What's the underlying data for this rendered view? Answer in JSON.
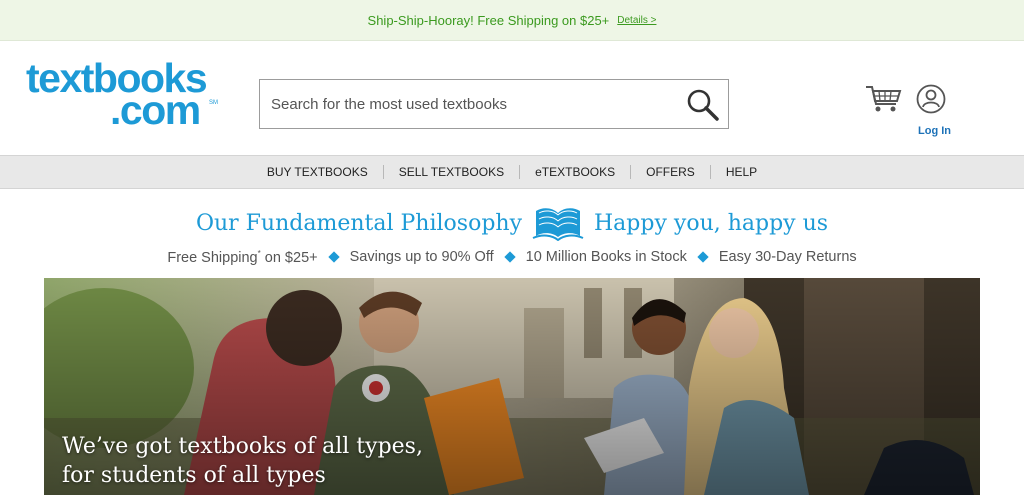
{
  "promo": {
    "text": "Ship-Ship-Hooray! Free Shipping on $25+",
    "link": "Details >"
  },
  "logo": {
    "line1": "textbooks",
    "line2": ".com",
    "sm": "SM"
  },
  "search": {
    "placeholder": "Search for the most used textbooks"
  },
  "header": {
    "login": "Log In"
  },
  "nav": {
    "items": [
      "BUY TEXTBOOKS",
      "SELL TEXTBOOKS",
      "eTEXTBOOKS",
      "OFFERS",
      "HELP"
    ]
  },
  "philosophy": {
    "left": "Our Fundamental Philosophy",
    "right": "Happy you, happy us"
  },
  "features": {
    "free_shipping": "Free Shipping",
    "asterisk": "*",
    "free_shipping_suffix": " on $25+",
    "savings": "Savings up to 90% Off",
    "stock": "10 Million Books in Stock",
    "returns": "Easy 30-Day Returns"
  },
  "hero": {
    "line1": "We’ve got textbooks of all types,",
    "line2": "for students of all types"
  },
  "colors": {
    "brand": "#1d9ad6",
    "promo_green": "#3b9a1f",
    "promo_bg": "#eef6e6",
    "nav_bg": "#e8e8e8"
  }
}
